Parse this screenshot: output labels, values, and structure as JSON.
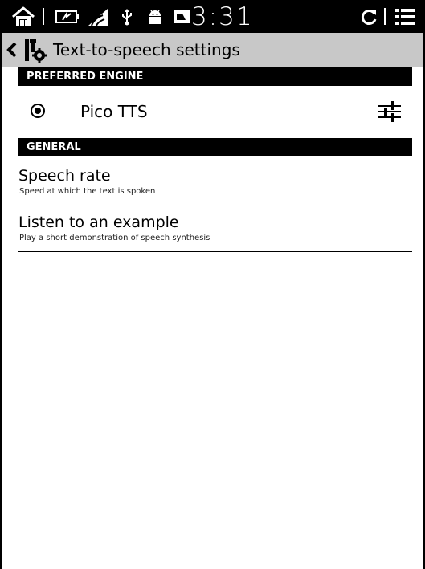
{
  "status_bar": {
    "clock": "3:31",
    "icons": [
      "home-icon",
      "battery-charging-icon",
      "wifi-signal-icon",
      "usb-icon",
      "android-icon",
      "storage-icon",
      "refresh-icon",
      "menu-icon"
    ]
  },
  "action_bar": {
    "title": "Text-to-speech settings",
    "icons": [
      "back-chevron-icon",
      "settings-tools-icon"
    ]
  },
  "sections": {
    "preferred_engine": "PREFERRED ENGINE",
    "general": "GENERAL"
  },
  "engine": {
    "name": "Pico TTS",
    "selected": true,
    "settings_icon": "sliders-icon"
  },
  "general_items": [
    {
      "title": "Speech rate",
      "subtitle": "Speed at which the text is spoken"
    },
    {
      "title": "Listen to an example",
      "subtitle": "Play a short demonstration of speech synthesis"
    }
  ],
  "colors": {
    "status_bar_bg": "#000000",
    "action_bar_bg": "#c8c8c8",
    "header_bg": "#000000",
    "page_bg": "#ffffff"
  }
}
